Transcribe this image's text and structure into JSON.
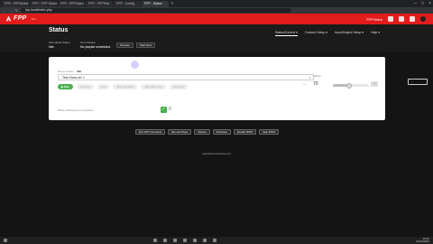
{
  "browser": {
    "tabs": [
      {
        "label": "FPP - FPPSelect"
      },
      {
        "label": "FPP - FPP Status"
      },
      {
        "label": "FPP - FPPVideo"
      },
      {
        "label": "FPP - FPPTest"
      },
      {
        "label": "FPP - Config"
      },
      {
        "label": "FPP - Status"
      }
    ],
    "new_tab_glyph": "+",
    "url": "fpp.local/index.php",
    "window_controls": [
      "–",
      "□",
      "×"
    ]
  },
  "header": {
    "logo_text": "FPP",
    "logo_sub": "v6.x",
    "instance_label": "FPPVideo",
    "brand_color": "#e21b1b"
  },
  "titlebar": {
    "page_title": "Status",
    "nav": [
      {
        "label": "Status/Control ▾",
        "active": true
      },
      {
        "label": "Content Setup ▾",
        "active": false
      },
      {
        "label": "Input/Output Setup ▾",
        "active": false
      },
      {
        "label": "Help ▾",
        "active": false
      }
    ],
    "info": [
      {
        "label": "Scheduled Status:",
        "value": "Idle"
      },
      {
        "label": "Next Playlist:",
        "value": "No playlist scheduled."
      }
    ],
    "buttons": [
      {
        "label": "Preview"
      },
      {
        "label": "Start Next"
      }
    ]
  },
  "main": {
    "playlist_label": "Player Status:",
    "playlist_status": "Idle",
    "playlist_select": "Test Show rev 1",
    "volume_label": "Volume:",
    "volume_value": "70",
    "volume_level": 0.45,
    "controls": [
      {
        "label": "▶ Play",
        "enabled": true
      },
      {
        "label": "Previous",
        "enabled": false
      },
      {
        "label": "Next",
        "enabled": false
      },
      {
        "label": "Stop Gracefully",
        "enabled": false
      },
      {
        "label": "Stop After Loop",
        "enabled": false
      },
      {
        "label": "Stop Now",
        "enabled": false
      }
    ],
    "repeat_label": "Blank w/Playlist Item Finishes",
    "toggle_state": "✓",
    "toggle_off": "0"
  },
  "footer": {
    "buttons": [
      {
        "label": "Run FPP Command"
      },
      {
        "label": "Remote Player"
      },
      {
        "label": "Reboot"
      },
      {
        "label": "Shutdown"
      },
      {
        "label": "Restart FPPD"
      },
      {
        "label": "Stop FPPD"
      }
    ],
    "link": "www.falconchristmas.com"
  },
  "taskbar": {
    "time": "10:42",
    "date": "12/14/2022"
  }
}
